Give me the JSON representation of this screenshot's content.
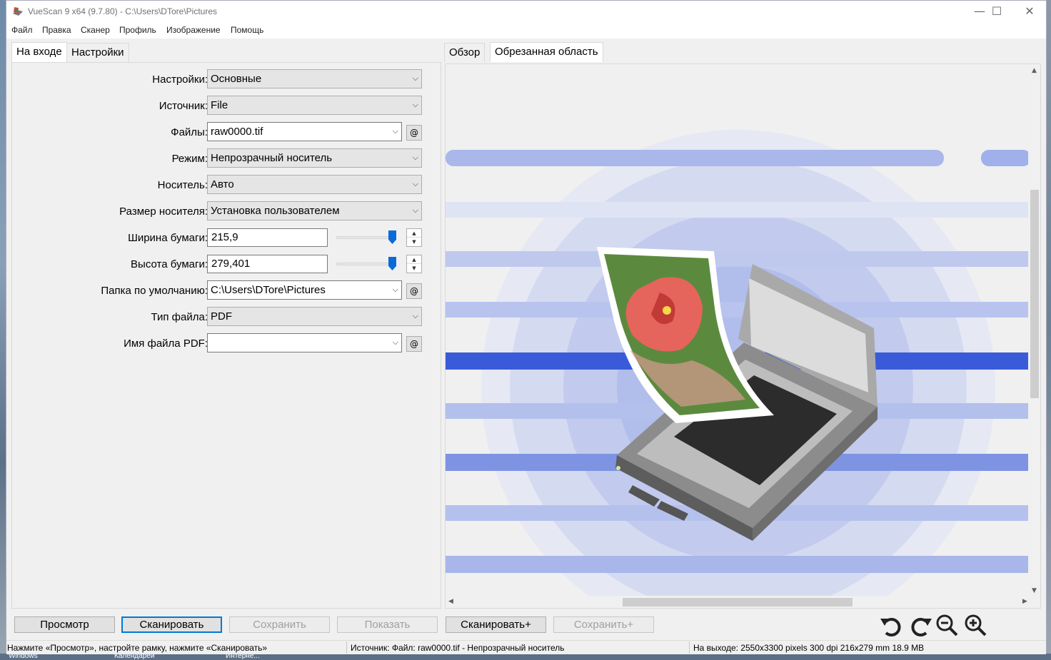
{
  "window": {
    "title": "VueScan 9 x64 (9.7.80) - C:\\Users\\DTore\\Pictures",
    "minimize": "—",
    "maximize": "☐",
    "close": "✕"
  },
  "menu": [
    "Файл",
    "Правка",
    "Сканер",
    "Профиль",
    "Изображение",
    "Помощь"
  ],
  "left_tabs": {
    "input": "На входе",
    "settings": "Настройки"
  },
  "right_tabs": {
    "overview": "Обзор",
    "crop": "Обрезанная область"
  },
  "form": {
    "settings": {
      "label": "Настройки:",
      "value": "Основные"
    },
    "source": {
      "label": "Источник:",
      "value": "File"
    },
    "files": {
      "label": "Файлы:",
      "value": "raw0000.tif"
    },
    "mode": {
      "label": "Режим:",
      "value": "Непрозрачный носитель"
    },
    "media": {
      "label": "Носитель:",
      "value": "Авто"
    },
    "media_size": {
      "label": "Размер носителя:",
      "value": "Установка пользователем"
    },
    "paper_width": {
      "label": "Ширина бумаги:",
      "value": "215,9",
      "slider_level": 1.0
    },
    "paper_height": {
      "label": "Высота бумаги:",
      "value": "279,401",
      "slider_level": 1.0
    },
    "default_folder": {
      "label": "Папка по умолчанию:",
      "value": "C:\\Users\\DTore\\Pictures"
    },
    "file_type": {
      "label": "Тип файла:",
      "value": "PDF"
    },
    "pdf_name": {
      "label": "Имя файла PDF:",
      "value": ""
    },
    "at_symbol": "@"
  },
  "buttons": {
    "preview": "Просмотр",
    "scan": "Сканировать",
    "save": "Сохранить",
    "show": "Показать",
    "scan_plus": "Сканировать+",
    "save_plus": "Сохранить+"
  },
  "toolbar_icons": [
    "rotate-left-icon",
    "rotate-right-icon",
    "zoom-out-icon",
    "zoom-in-icon"
  ],
  "status": {
    "hint": "Нажмите «Просмотр», настройте рамку, нажмите «Сканировать»",
    "source": "Источник: Файл: raw0000.tif - Непрозрачный носитель",
    "output": "На выходе: 2550x3300 pixels 300 dpi 216x279 mm 18.9 MB"
  },
  "taskbar": [
    "Windows",
    "Календарей",
    "Интерне..."
  ],
  "colors": {
    "accent": "#0078d7",
    "stripe": "#3a5bd9",
    "stripe_light": "#a9b7ea"
  }
}
